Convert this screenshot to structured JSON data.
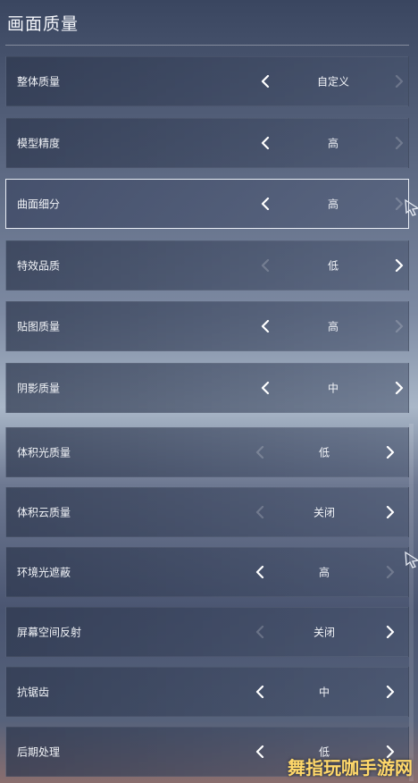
{
  "header": {
    "title": "画面质量"
  },
  "settings_top": [
    {
      "label": "整体质量",
      "value": "自定义",
      "left_enabled": true,
      "right_enabled": false
    },
    {
      "label": "模型精度",
      "value": "高",
      "left_enabled": true,
      "right_enabled": false
    },
    {
      "label": "曲面细分",
      "value": "高",
      "left_enabled": true,
      "right_enabled": false,
      "selected": true
    },
    {
      "label": "特效品质",
      "value": "低",
      "left_enabled": false,
      "right_enabled": true
    },
    {
      "label": "贴图质量",
      "value": "高",
      "left_enabled": true,
      "right_enabled": false
    },
    {
      "label": "阴影质量",
      "value": "中",
      "left_enabled": true,
      "right_enabled": true
    }
  ],
  "settings_bottom": [
    {
      "label": "体积光质量",
      "value": "低",
      "left_enabled": false,
      "right_enabled": true
    },
    {
      "label": "体积云质量",
      "value": "关闭",
      "left_enabled": false,
      "right_enabled": true
    },
    {
      "label": "环境光遮蔽",
      "value": "高",
      "left_enabled": true,
      "right_enabled": false
    },
    {
      "label": "屏幕空间反射",
      "value": "关闭",
      "left_enabled": false,
      "right_enabled": true
    },
    {
      "label": "抗锯齿",
      "value": "中",
      "left_enabled": true,
      "right_enabled": true
    },
    {
      "label": "后期处理",
      "value": "低",
      "left_enabled": true,
      "right_enabled": true
    }
  ],
  "watermark": {
    "text": "舞指玩咖手游网"
  },
  "colors": {
    "selected_border": "#e9edf5",
    "watermark": "#ffd86a"
  }
}
